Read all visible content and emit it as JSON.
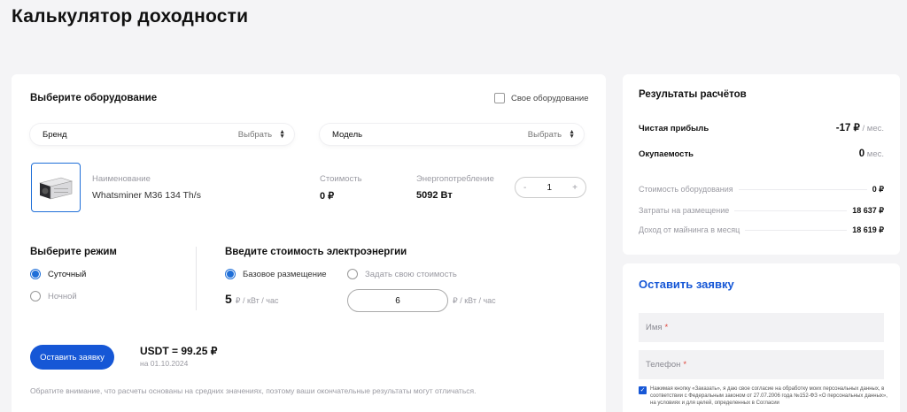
{
  "page_title": "Калькулятор доходности",
  "equipment": {
    "heading": "Выберите оборудование",
    "own_equipment_label": "Свое оборудование",
    "brand": {
      "label": "Бренд",
      "value": "Выбрать"
    },
    "model": {
      "label": "Модель",
      "value": "Выбрать"
    },
    "item": {
      "name_label": "Наименование",
      "name": "Whatsminer M36 134 Th/s",
      "cost_label": "Стоимость",
      "cost": "0 ₽",
      "power_label": "Энергопотребление",
      "power": "5092 Вт",
      "quantity": "1",
      "minus": "-",
      "plus": "+"
    }
  },
  "mode": {
    "heading": "Выберите режим",
    "options": [
      "Суточный",
      "Ночной"
    ],
    "selected": 0
  },
  "electricity": {
    "heading": "Введите стоимость электроэнергии",
    "base_label": "Базовое размещение",
    "custom_label": "Задать свою стоимость",
    "base_price": "5",
    "base_unit": "₽ / кВт / час",
    "custom_value": "6",
    "custom_unit": "₽ / кВт / час"
  },
  "action": {
    "button": "Оставить заявку",
    "rate": "USDT = 99.25 ₽",
    "rate_date": "на 01.10.2024",
    "note": "Обратите внимание, что расчеты основаны на средних значениях, поэтому ваши окончательные результаты могут отличаться."
  },
  "results": {
    "heading": "Результаты расчётов",
    "net_profit_label": "Чистая прибыль",
    "net_profit_value": "-17 ₽",
    "net_profit_unit": "/ мес.",
    "payback_label": "Окупаемость",
    "payback_value": "0",
    "payback_unit": "мес.",
    "rows": [
      {
        "label": "Стоимость оборудования",
        "value": "0 ₽"
      },
      {
        "label": "Затраты на размещение",
        "value": "18 637 ₽"
      },
      {
        "label": "Доход от майнинга в месяц",
        "value": "18 619 ₽"
      }
    ]
  },
  "order": {
    "heading": "Оставить заявку",
    "name_placeholder": "Имя",
    "phone_placeholder": "Телефон",
    "required_mark": "*",
    "consent": "Нажимая кнопку «Заказать», я даю свое согласие на обработку моих персональных данных, в соответствии с Федеральным законом от 27.07.2006 года №152-ФЗ «О персональных данных», на условиях и для целей, определенных в Согласии"
  },
  "colors": {
    "accent": "#1657d6",
    "required": "#e0453c",
    "background": "#f4f4f6"
  }
}
